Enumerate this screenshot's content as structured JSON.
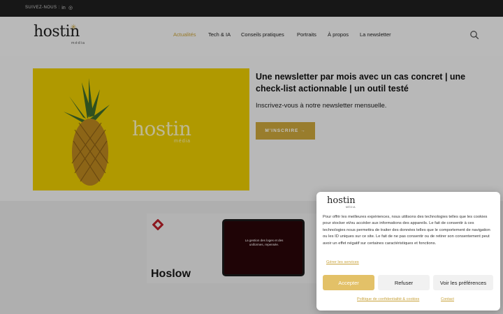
{
  "topbar": {
    "follow_label": "SUIVEZ-NOUS :",
    "social": [
      {
        "icon": "linkedin-icon",
        "glyph": "in"
      },
      {
        "icon": "instagram-icon",
        "glyph": "◎"
      }
    ]
  },
  "header": {
    "logo_text": "hostin",
    "logo_sub": "média",
    "nav": [
      {
        "label": "Actualités",
        "active": true
      },
      {
        "label": "Tech & IA"
      },
      {
        "label": "Conseils pratiques"
      },
      {
        "label": "Portraits"
      },
      {
        "label": "À propos"
      },
      {
        "label": "La newsletter"
      }
    ],
    "search_icon": "search-icon"
  },
  "hero": {
    "watermark": "hostin",
    "watermark_sub": "média",
    "headline": "Une newsletter par mois avec un cas concret | une check-list actionnable | un outil testé",
    "subline": "Inscrivez-vous à notre newsletter mensuelle.",
    "cta_label": "M'INSCRIRE →",
    "accent_color": "#c9a53c",
    "image_bg": "#e8c900"
  },
  "ad": {
    "brand": "Hoslow",
    "tablet_text": "La gestion des loges et des uniformes, repensée."
  },
  "cookie_banner": {
    "logo_text": "hostin",
    "logo_sub": "MÉDIA",
    "text": "Pour offrir les meilleures expériences, nous utilisons des technologies telles que les cookies pour stocker et/ou accéder aux informations des appareils. Le fait de consentir à ces technologies nous permettra de traiter des données telles que le comportement de navigation ou les ID uniques sur ce site. Le fait de ne pas consentir ou de retirer son consentement peut avoir un effet négatif sur certaines caractéristiques et fonctions.",
    "manage_link": "Gérer les services",
    "accept_label": "Accepter",
    "refuse_label": "Refuser",
    "prefs_label": "Voir les préférences",
    "privacy_link": "Politique de confidentialité & cookies",
    "contact_link": "Contact"
  }
}
